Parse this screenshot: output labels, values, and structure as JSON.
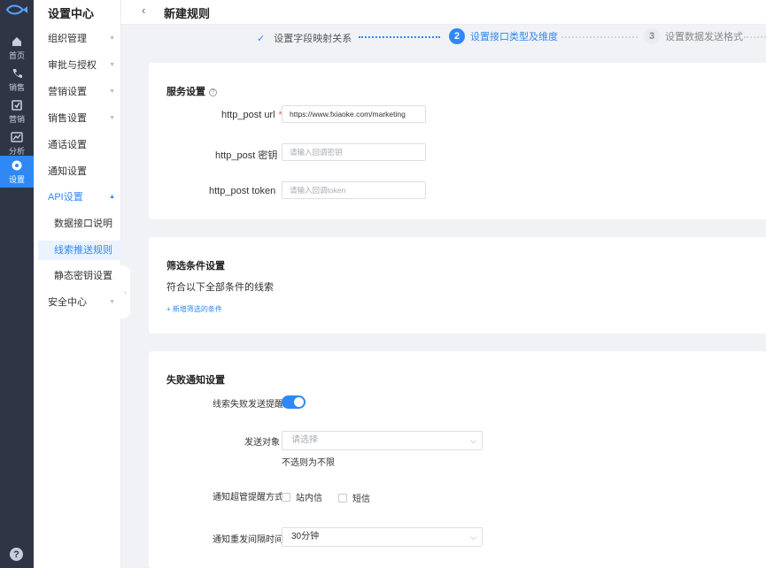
{
  "rail": {
    "items": [
      {
        "label": "首页",
        "icon": "home-icon"
      },
      {
        "label": "销售",
        "icon": "phone-icon"
      },
      {
        "label": "营销",
        "icon": "marketing-icon"
      },
      {
        "label": "分析",
        "icon": "analytics-icon"
      },
      {
        "label": "设置",
        "icon": "settings-icon",
        "active": true
      }
    ],
    "help": "?"
  },
  "sidebar": {
    "title": "设置中心",
    "items": [
      {
        "label": "组织管理"
      },
      {
        "label": "审批与授权"
      },
      {
        "label": "营销设置"
      },
      {
        "label": "销售设置"
      },
      {
        "label": "通话设置"
      },
      {
        "label": "通知设置"
      },
      {
        "label": "API设置"
      },
      {
        "label": "安全中心"
      }
    ],
    "api_children": [
      {
        "label": "数据接口说明"
      },
      {
        "label": "线索推送规则",
        "active": true
      },
      {
        "label": "静态密钥设置"
      }
    ]
  },
  "header": {
    "back": "‹",
    "title": "新建规则"
  },
  "steps": [
    {
      "label": "设置字段映射关系",
      "state": "done"
    },
    {
      "num": "2",
      "label": "设置接口类型及维度",
      "state": "current"
    },
    {
      "num": "3",
      "label": "设置数据发送格式",
      "state": "pending"
    }
  ],
  "service": {
    "title": "服务设置",
    "help": "?",
    "url_label": "http_post url",
    "url_required": "*",
    "url_value": "https://www.fxiaoke.com/marketing",
    "key_label": "http_post 密钥",
    "key_placeholder": "请输入回调密钥",
    "token_label": "http_post token",
    "token_placeholder": "请输入回调token"
  },
  "filter": {
    "title": "筛选条件设置",
    "desc": "符合以下全部条件的线索",
    "add_link": "+ 新增筛选的条件"
  },
  "failure": {
    "title": "失败通知设置",
    "toggle_label": "线索失败发送提醒",
    "toggle_on": true,
    "target_label": "发送对象",
    "target_placeholder": "请选择",
    "target_hint": "不选则为不限",
    "method_label": "通知超管提醒方式",
    "method_options": [
      {
        "label": "站内信"
      },
      {
        "label": "短信"
      }
    ],
    "interval_label": "通知重发间隔时间",
    "interval_value": "30分钟"
  },
  "colors": {
    "accent": "#2f88f6",
    "rail_bg": "#2f3545",
    "required": "#f25454"
  }
}
